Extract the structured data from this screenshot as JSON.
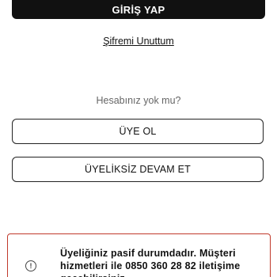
{
  "login": {
    "button_label": "GİRİŞ YAP"
  },
  "forgot_password": {
    "link_label": "Şifremi Unuttum"
  },
  "signup_section": {
    "prompt": "Hesabınız yok mu?",
    "signup_label": "ÜYE OL",
    "guest_label": "ÜYELİKSİZ DEVAM ET"
  },
  "alert": {
    "icon": "info-icon",
    "message": "Üyeliğiniz pasif durumdadır. Müşteri hizmetleri ile 0850 360 28 82 iletişime geçebilirsiniz.",
    "border_color": "#c0392b"
  }
}
